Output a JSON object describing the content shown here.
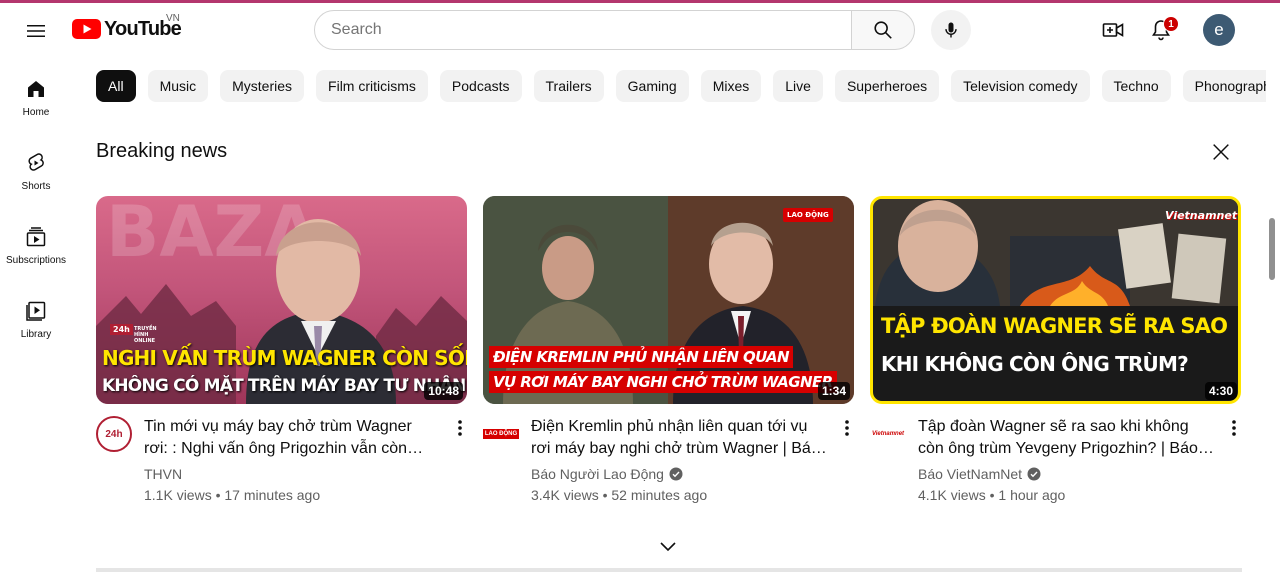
{
  "header": {
    "logo_text": "YouTube",
    "country_code": "VN",
    "search_placeholder": "Search",
    "notification_count": "1",
    "avatar_letter": "e"
  },
  "sidebar": {
    "items": [
      {
        "label": "Home",
        "icon": "home-icon"
      },
      {
        "label": "Shorts",
        "icon": "shorts-icon"
      },
      {
        "label": "Subscriptions",
        "icon": "subscriptions-icon"
      },
      {
        "label": "Library",
        "icon": "library-icon"
      }
    ]
  },
  "chips": [
    "All",
    "Music",
    "Mysteries",
    "Film criticisms",
    "Podcasts",
    "Trailers",
    "Gaming",
    "Mixes",
    "Live",
    "Superheroes",
    "Television comedy",
    "Techno",
    "Phonograph"
  ],
  "shelf": {
    "title": "Breaking news",
    "videos": [
      {
        "title": "Tin mới vụ máy bay chở trùm Wagner rơi: : Nghi vấn ông Prigozhin vẫn còn sống?",
        "channel": "THVN",
        "verified": false,
        "views": "1.1K views",
        "age": "17 minutes ago",
        "duration": "10:48",
        "thumb_line1": "NGHI VẤN TRÙM WAGNER CÒN SỐNG",
        "thumb_line2": "KHÔNG CÓ MẶT TRÊN MÁY BAY TƯ NHÂN ?",
        "thumb_brand": "24h",
        "thumb_brand_sub": "TRUYỀN HÌNH ONLINE",
        "avatar_text": "24h"
      },
      {
        "title": "Điện Kremlin phủ nhận liên quan tới vụ rơi máy bay nghi chở trùm Wagner | Báo Lao Động",
        "channel": "Báo Người Lao Động",
        "verified": true,
        "views": "3.4K views",
        "age": "52 minutes ago",
        "duration": "1:34",
        "thumb_line1": "ĐIỆN KREMLIN PHỦ NHẬN LIÊN QUAN",
        "thumb_line2": "VỤ RƠI MÁY BAY NGHI CHỞ TRÙM WAGNER",
        "thumb_brand": "LAO ĐỘNG",
        "avatar_text": "LAO ĐỘNG"
      },
      {
        "title": "Tập đoàn Wagner sẽ ra sao khi không còn ông trùm Yevgeny Prigozhin? | Báo VietNamNet",
        "channel": "Báo VietNamNet",
        "verified": true,
        "views": "4.1K views",
        "age": "1 hour ago",
        "duration": "4:30",
        "thumb_line1": "TẬP ĐOÀN WAGNER SẼ RA SAO",
        "thumb_line2": "KHI KHÔNG CÒN ÔNG TRÙM?",
        "thumb_brand": "Vietnamnet",
        "avatar_text": "Vietnamnet"
      }
    ]
  },
  "colors": {
    "brand_red": "#ff0000",
    "chip_bg": "#f2f2f2",
    "chip_active_bg": "#0f0f0f",
    "secondary_text": "#606060",
    "thumb_yellow": "#ffe500"
  }
}
